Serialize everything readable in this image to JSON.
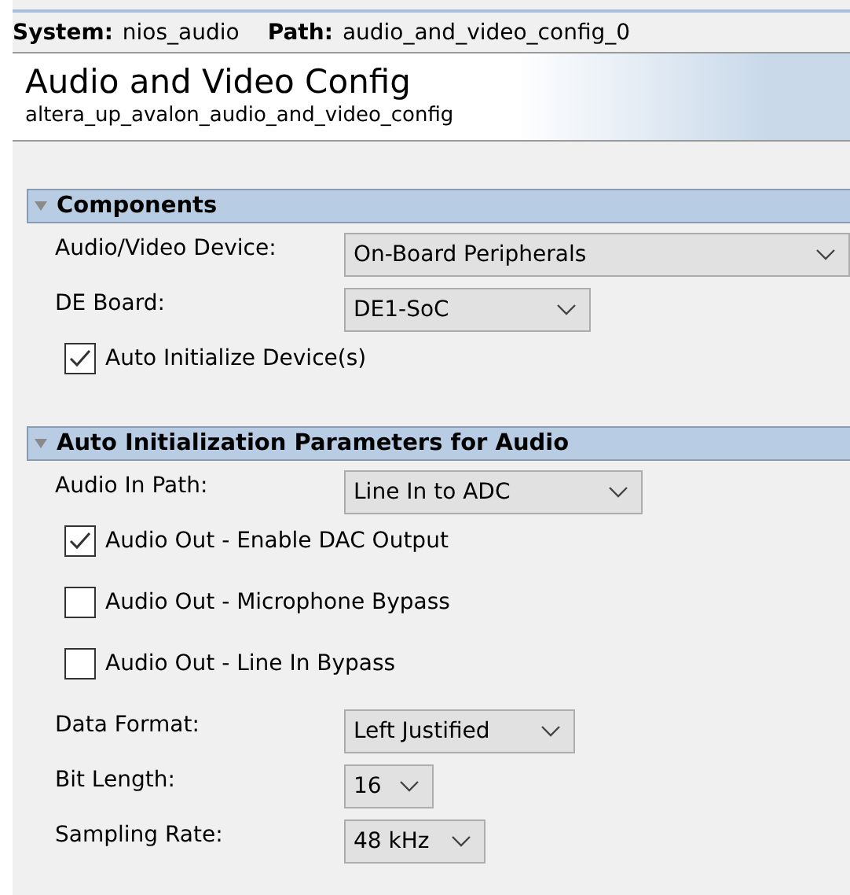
{
  "path_bar": {
    "system_label": "System:",
    "system": "nios_audio",
    "path_label": "Path:",
    "path": "audio_and_video_config_0"
  },
  "header": {
    "title": "Audio and Video Config",
    "subtitle": "altera_up_avalon_audio_and_video_config"
  },
  "sections": [
    {
      "title": "Components",
      "expanded": true,
      "items": [
        {
          "kind": "select",
          "label": "Audio/Video Device:",
          "value": "On-Board Peripherals"
        },
        {
          "kind": "select",
          "label": "DE Board:",
          "value": "DE1-SoC"
        },
        {
          "kind": "checkbox",
          "label": "Auto Initialize Device(s)",
          "checked": true
        }
      ]
    },
    {
      "title": "Auto Initialization Parameters for Audio",
      "expanded": true,
      "items": [
        {
          "kind": "select",
          "label": "Audio In Path:",
          "value": "Line In to ADC"
        },
        {
          "kind": "checkbox",
          "label": "Audio Out - Enable DAC Output",
          "checked": true
        },
        {
          "kind": "checkbox",
          "label": "Audio Out - Microphone Bypass",
          "checked": false
        },
        {
          "kind": "checkbox",
          "label": "Audio Out - Line In Bypass",
          "checked": false
        },
        {
          "kind": "select",
          "label": "Data Format:",
          "value": "Left Justified"
        },
        {
          "kind": "select",
          "label": "Bit Length:",
          "value": "16"
        },
        {
          "kind": "select",
          "label": "Sampling Rate:",
          "value": "48 kHz"
        }
      ]
    }
  ]
}
